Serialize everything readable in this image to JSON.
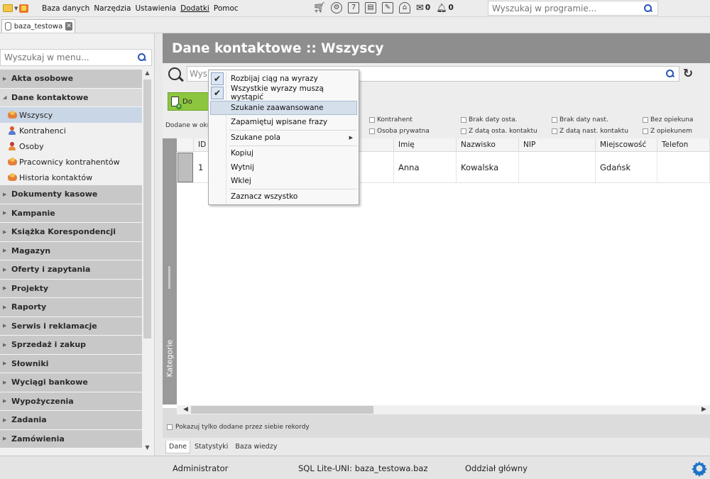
{
  "menubar": {
    "items": [
      "Baza danych",
      "Narzędzia",
      "Ustawienia",
      "Dodatki",
      "Pomoc"
    ],
    "messages_count": "0",
    "notifications_count": "0",
    "search_placeholder": "Wyszukaj w programie..."
  },
  "db_tab": {
    "label": "baza_testowa"
  },
  "sidebar": {
    "search_placeholder": "Wyszukaj w menu...",
    "categories": [
      {
        "label": "Akta osobowe",
        "open": false
      },
      {
        "label": "Dane kontaktowe",
        "open": true,
        "children": [
          {
            "label": "Wszyscy",
            "icon": "group-icon",
            "active": true
          },
          {
            "label": "Kontrahenci",
            "icon": "person-icon"
          },
          {
            "label": "Osoby",
            "icon": "person-icon"
          },
          {
            "label": "Pracownicy kontrahentów",
            "icon": "group-icon"
          },
          {
            "label": "Historia kontaktów",
            "icon": "group-icon"
          }
        ]
      },
      {
        "label": "Dokumenty kasowe"
      },
      {
        "label": "Kampanie"
      },
      {
        "label": "Książka Korespondencji"
      },
      {
        "label": "Magazyn"
      },
      {
        "label": "Oferty i zapytania"
      },
      {
        "label": "Projekty"
      },
      {
        "label": "Raporty"
      },
      {
        "label": "Serwis i reklamacje"
      },
      {
        "label": "Sprzedaż i zakup"
      },
      {
        "label": "Słowniki"
      },
      {
        "label": "Wyciągi bankowe"
      },
      {
        "label": "Wypożyczenia"
      },
      {
        "label": "Zadania"
      },
      {
        "label": "Zamówienia"
      }
    ]
  },
  "main": {
    "title": "Dane kontaktowe :: Wszyscy",
    "search_value": "Wys",
    "add_button_label": "Do",
    "added_label": "Dodane w okr",
    "filters": [
      "Kontrahent",
      "Osoba prywatna",
      "Brak daty osta.",
      "Z datą osta. kontaktu",
      "Brak daty nast.",
      "Z datą nast. kontaktu",
      "Bez opiekuna",
      "Z opiekunem"
    ],
    "grid": {
      "columns": [
        "ID",
        "Imię",
        "Nazwisko",
        "NIP",
        "Miejscowość",
        "Telefon"
      ],
      "rows": [
        {
          "id": "1",
          "imie": "Anna",
          "nazwisko": "Kowalska",
          "nip": "",
          "miejscowosc": "Gdańsk",
          "telefon": ""
        }
      ]
    },
    "kategorie_label": "Kategorie",
    "own_records_label": "Pokazuj tylko dodane przez siebie rekordy",
    "bottom_tabs": [
      "Dane",
      "Statystyki",
      "Baza wiedzy"
    ]
  },
  "context_menu": {
    "items": [
      {
        "label": "Rozbijaj ciąg na wyrazy",
        "checked": true
      },
      {
        "label": "Wszystkie wyrazy muszą wystąpić",
        "checked": true
      },
      {
        "label": "Szukanie zaawansowane",
        "hover": true
      },
      {
        "label": "Zapamiętuj wpisane frazy"
      },
      {
        "label": "Szukane pola",
        "submenu": true
      },
      {
        "label": "Kopiuj"
      },
      {
        "label": "Wytnij"
      },
      {
        "label": "Wklej"
      },
      {
        "label": "Zaznacz wszystko"
      }
    ]
  },
  "statusbar": {
    "user": "Administrator",
    "database": "SQL Lite-UNI: baza_testowa.baz",
    "branch": "Oddział główny"
  },
  "colors": {
    "header_gray": "#8e8e8e",
    "add_button_green": "#8cc63f",
    "gear_blue": "#1a73c8",
    "search_icon_blue": "#2a55b8"
  }
}
